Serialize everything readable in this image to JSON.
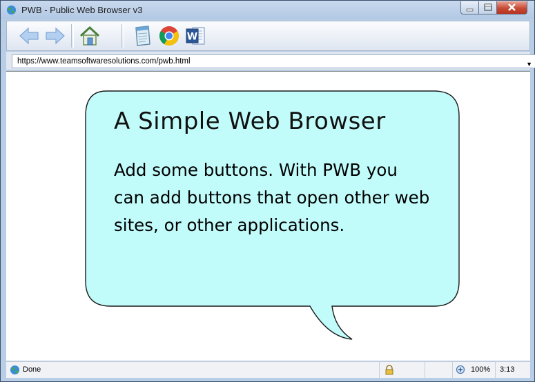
{
  "window": {
    "title": "PWB - Public Web Browser v3"
  },
  "toolbar": {
    "buttons": [
      {
        "name": "back-arrow-icon"
      },
      {
        "name": "forward-arrow-icon"
      },
      {
        "name": "home-icon"
      },
      {
        "name": "notepad-icon"
      },
      {
        "name": "chrome-icon"
      },
      {
        "name": "word-icon",
        "letter": "W"
      }
    ]
  },
  "address": {
    "url": "https://www.teamsoftwaresolutions.com/pwb.html"
  },
  "page": {
    "heading": "A Simple Web Browser",
    "body": "Add some buttons. With PWB you can add buttons that open other web sites, or other applications."
  },
  "status": {
    "text": "Done",
    "zoom": "100%",
    "time": "3:13"
  },
  "colors": {
    "bubble": "#c1fcfb",
    "chrome_accent": "#b8cde6"
  }
}
